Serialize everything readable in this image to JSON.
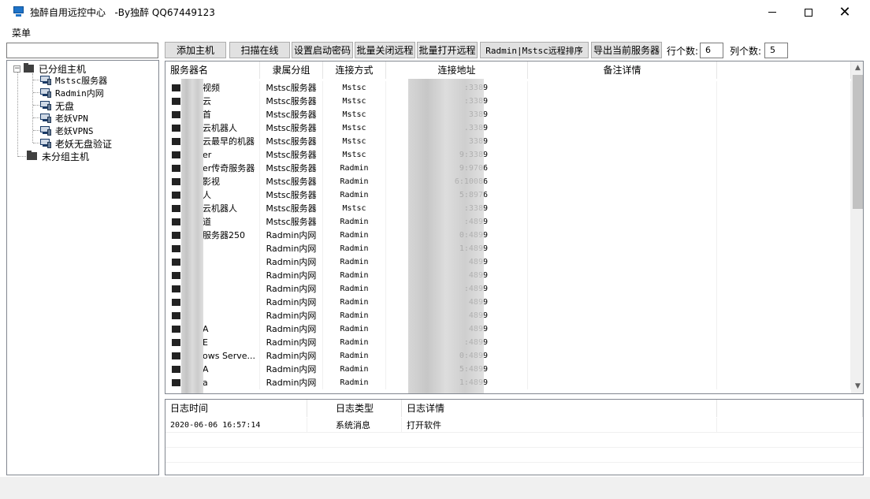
{
  "window": {
    "title": "独醉自用远控中心   -By独醉 QQ67449123"
  },
  "menu": {
    "label": "菜单"
  },
  "tree": {
    "grouped_label": "已分组主机",
    "groups": [
      "Mstsc服务器",
      "Radmin内网",
      "无盘",
      "老妖VPN",
      "老妖VPNS",
      "老妖无盘验证"
    ],
    "ungrouped_label": "未分组主机"
  },
  "toolbar": {
    "add_host": "添加主机",
    "scan_online": "扫描在线",
    "set_boot_password": "设置启动密码",
    "batch_close": "批量关闭远程",
    "batch_open": "批量打开远程",
    "sort_remote": "Radmin|Mstsc远程排序",
    "export_servers": "导出当前服务器",
    "rows_label": "行个数:",
    "rows_value": "6",
    "cols_label": "列个数:",
    "cols_value": "5"
  },
  "list": {
    "columns": [
      "服务器名",
      "隶属分组",
      "连接方式",
      "连接地址",
      "备注详情"
    ],
    "rows": [
      {
        "name": "视频",
        "group": "Mstsc服务器",
        "mode": "Mstsc",
        "addr": ":3389"
      },
      {
        "name": "云",
        "group": "Mstsc服务器",
        "mode": "Mstsc",
        "addr": ":3389"
      },
      {
        "name": "首",
        "group": "Mstsc服务器",
        "mode": "Mstsc",
        "addr": "3389"
      },
      {
        "name": "云机器人",
        "group": "Mstsc服务器",
        "mode": "Mstsc",
        "addr": ".3389"
      },
      {
        "name": "云最早的机器",
        "group": "Mstsc服务器",
        "mode": "Mstsc",
        "addr": "3389"
      },
      {
        "name": "er",
        "group": "Mstsc服务器",
        "mode": "Mstsc",
        "addr": "9:3389"
      },
      {
        "name": "er传奇服务器",
        "group": "Mstsc服务器",
        "mode": "Radmin",
        "addr": "9:9706"
      },
      {
        "name": "影视",
        "group": "Mstsc服务器",
        "mode": "Radmin",
        "addr": "6:10086"
      },
      {
        "name": "人",
        "group": "Mstsc服务器",
        "mode": "Radmin",
        "addr": "5:8976"
      },
      {
        "name": "云机器人",
        "group": "Mstsc服务器",
        "mode": "Mstsc",
        "addr": ":3389"
      },
      {
        "name": "道",
        "group": "Mstsc服务器",
        "mode": "Radmin",
        "addr": ":4899"
      },
      {
        "name": "服务器250",
        "group": "Radmin内网",
        "mode": "Radmin",
        "addr": "0:4899"
      },
      {
        "name": "",
        "group": "Radmin内网",
        "mode": "Radmin",
        "addr": "1:4899"
      },
      {
        "name": "",
        "group": "Radmin内网",
        "mode": "Radmin",
        "addr": "4899"
      },
      {
        "name": "",
        "group": "Radmin内网",
        "mode": "Radmin",
        "addr": "4899"
      },
      {
        "name": "",
        "group": "Radmin内网",
        "mode": "Radmin",
        "addr": ":4899"
      },
      {
        "name": "",
        "group": "Radmin内网",
        "mode": "Radmin",
        "addr": "4899"
      },
      {
        "name": "",
        "group": "Radmin内网",
        "mode": "Radmin",
        "addr": "4899"
      },
      {
        "name": "A",
        "group": "Radmin内网",
        "mode": "Radmin",
        "addr": "4899"
      },
      {
        "name": "E",
        "group": "Radmin内网",
        "mode": "Radmin",
        "addr": ":4899"
      },
      {
        "name": "ows Serve...",
        "group": "Radmin内网",
        "mode": "Radmin",
        "addr": "0:4899"
      },
      {
        "name": "A",
        "group": "Radmin内网",
        "mode": "Radmin",
        "addr": "5:4899"
      },
      {
        "name": "a",
        "group": "Radmin内网",
        "mode": "Radmin",
        "addr": "1:4899"
      }
    ]
  },
  "log": {
    "columns": [
      "日志时间",
      "日志类型",
      "日志详情"
    ],
    "rows": [
      {
        "time": "2020-06-06 16:57:14",
        "type": "系统消息",
        "detail": "打开软件"
      }
    ]
  },
  "icons": {
    "app": "remote-desktop-icon",
    "folder": "folder-icon",
    "host": "computer-icon"
  }
}
